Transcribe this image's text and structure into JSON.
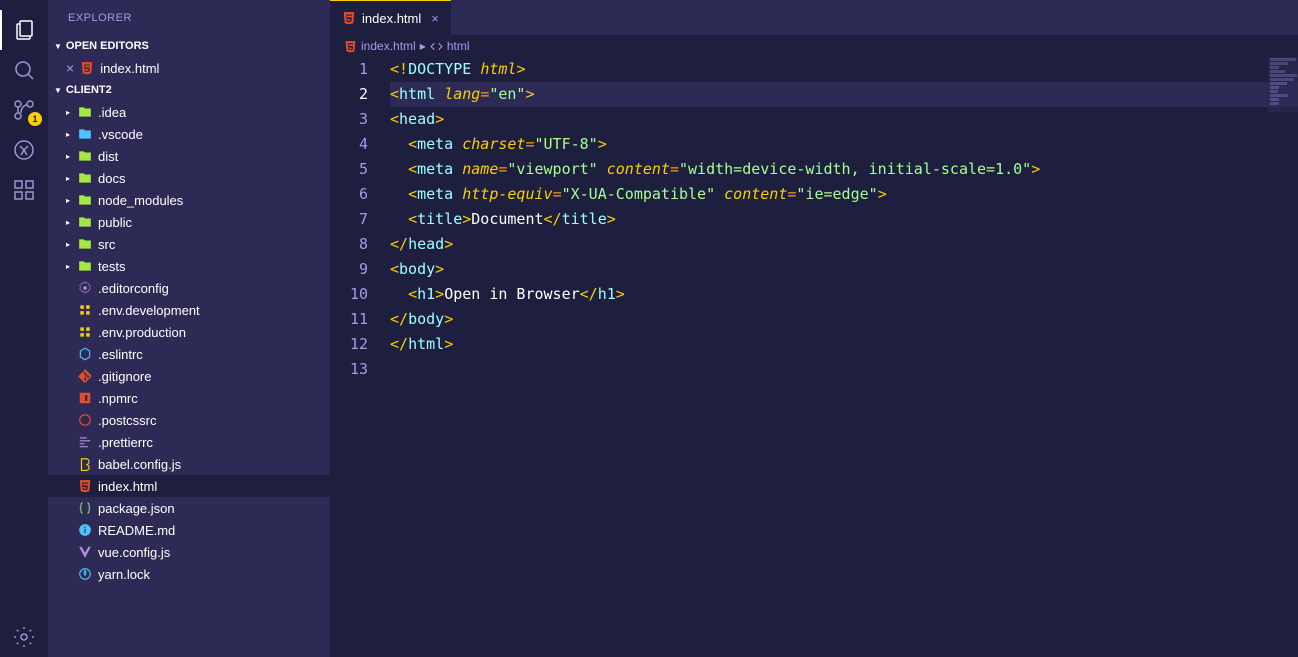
{
  "sidebar_title": "EXPLORER",
  "sections": {
    "open_editors": "OPEN EDITORS",
    "project": "CLIENT2"
  },
  "open_editors": [
    {
      "name": "index.html"
    }
  ],
  "scm_badge": "1",
  "tree": [
    {
      "name": ".idea",
      "type": "folder",
      "icon": "folder",
      "color": "folder-icon"
    },
    {
      "name": ".vscode",
      "type": "folder",
      "icon": "folder",
      "color": "folder-icon-blue"
    },
    {
      "name": "dist",
      "type": "folder",
      "icon": "folder",
      "color": "folder-icon"
    },
    {
      "name": "docs",
      "type": "folder",
      "icon": "folder",
      "color": "folder-icon"
    },
    {
      "name": "node_modules",
      "type": "folder",
      "icon": "folder",
      "color": "folder-icon"
    },
    {
      "name": "public",
      "type": "folder",
      "icon": "folder",
      "color": "folder-icon"
    },
    {
      "name": "src",
      "type": "folder",
      "icon": "folder",
      "color": "folder-icon"
    },
    {
      "name": "tests",
      "type": "folder",
      "icon": "folder",
      "color": "folder-icon"
    },
    {
      "name": ".editorconfig",
      "type": "file",
      "icon": "gear",
      "color": "file-purple"
    },
    {
      "name": ".env.development",
      "type": "file",
      "icon": "env",
      "color": "file-yellow"
    },
    {
      "name": ".env.production",
      "type": "file",
      "icon": "env",
      "color": "file-yellow"
    },
    {
      "name": ".eslintrc",
      "type": "file",
      "icon": "eslint",
      "color": "file-blue"
    },
    {
      "name": ".gitignore",
      "type": "file",
      "icon": "git",
      "color": "file-orange"
    },
    {
      "name": ".npmrc",
      "type": "file",
      "icon": "npm",
      "color": "file-red"
    },
    {
      "name": ".postcssrc",
      "type": "file",
      "icon": "postcss",
      "color": "file-red"
    },
    {
      "name": ".prettierrc",
      "type": "file",
      "icon": "prettier",
      "color": "file-purple"
    },
    {
      "name": "babel.config.js",
      "type": "file",
      "icon": "babel",
      "color": "file-yellow"
    },
    {
      "name": "index.html",
      "type": "file",
      "icon": "html",
      "color": "file-orange",
      "selected": true
    },
    {
      "name": "package.json",
      "type": "file",
      "icon": "json",
      "color": "file-green"
    },
    {
      "name": "README.md",
      "type": "file",
      "icon": "info",
      "color": "file-blue"
    },
    {
      "name": "vue.config.js",
      "type": "file",
      "icon": "vue",
      "color": "file-purple"
    },
    {
      "name": "yarn.lock",
      "type": "file",
      "icon": "yarn",
      "color": "file-blue"
    }
  ],
  "tab": {
    "name": "index.html"
  },
  "breadcrumb": {
    "file": "index.html",
    "element": "html"
  },
  "code": {
    "current_line": 2,
    "lines": [
      [
        {
          "t": "bracket",
          "v": "<!"
        },
        {
          "t": "tag",
          "v": "DOCTYPE "
        },
        {
          "t": "attr",
          "v": "html"
        },
        {
          "t": "bracket",
          "v": ">"
        }
      ],
      [
        {
          "t": "bracket",
          "v": "<"
        },
        {
          "t": "tag",
          "v": "html "
        },
        {
          "t": "attr",
          "v": "lang"
        },
        {
          "t": "op",
          "v": "="
        },
        {
          "t": "str",
          "v": "\"en\""
        },
        {
          "t": "bracket",
          "v": ">"
        }
      ],
      [
        {
          "t": "bracket",
          "v": "<"
        },
        {
          "t": "tag",
          "v": "head"
        },
        {
          "t": "bracket",
          "v": ">"
        }
      ],
      [
        {
          "t": "text",
          "v": "  "
        },
        {
          "t": "bracket",
          "v": "<"
        },
        {
          "t": "tag",
          "v": "meta "
        },
        {
          "t": "attr",
          "v": "charset"
        },
        {
          "t": "op",
          "v": "="
        },
        {
          "t": "str",
          "v": "\"UTF-8\""
        },
        {
          "t": "bracket",
          "v": ">"
        }
      ],
      [
        {
          "t": "text",
          "v": "  "
        },
        {
          "t": "bracket",
          "v": "<"
        },
        {
          "t": "tag",
          "v": "meta "
        },
        {
          "t": "attr",
          "v": "name"
        },
        {
          "t": "op",
          "v": "="
        },
        {
          "t": "str",
          "v": "\"viewport\""
        },
        {
          "t": "tag",
          "v": " "
        },
        {
          "t": "attr",
          "v": "content"
        },
        {
          "t": "op",
          "v": "="
        },
        {
          "t": "str",
          "v": "\"width=device-width, initial-scale=1.0\""
        },
        {
          "t": "bracket",
          "v": ">"
        }
      ],
      [
        {
          "t": "text",
          "v": "  "
        },
        {
          "t": "bracket",
          "v": "<"
        },
        {
          "t": "tag",
          "v": "meta "
        },
        {
          "t": "attr",
          "v": "http-equiv"
        },
        {
          "t": "op",
          "v": "="
        },
        {
          "t": "str",
          "v": "\"X-UA-Compatible\""
        },
        {
          "t": "tag",
          "v": " "
        },
        {
          "t": "attr",
          "v": "content"
        },
        {
          "t": "op",
          "v": "="
        },
        {
          "t": "str",
          "v": "\"ie=edge\""
        },
        {
          "t": "bracket",
          "v": ">"
        }
      ],
      [
        {
          "t": "text",
          "v": "  "
        },
        {
          "t": "bracket",
          "v": "<"
        },
        {
          "t": "tag",
          "v": "title"
        },
        {
          "t": "bracket",
          "v": ">"
        },
        {
          "t": "text",
          "v": "Document"
        },
        {
          "t": "bracket",
          "v": "</"
        },
        {
          "t": "tag",
          "v": "title"
        },
        {
          "t": "bracket",
          "v": ">"
        }
      ],
      [
        {
          "t": "bracket",
          "v": "</"
        },
        {
          "t": "tag",
          "v": "head"
        },
        {
          "t": "bracket",
          "v": ">"
        }
      ],
      [
        {
          "t": "bracket",
          "v": "<"
        },
        {
          "t": "tag",
          "v": "body"
        },
        {
          "t": "bracket",
          "v": ">"
        }
      ],
      [
        {
          "t": "text",
          "v": "  "
        },
        {
          "t": "bracket",
          "v": "<"
        },
        {
          "t": "tag",
          "v": "h1"
        },
        {
          "t": "bracket",
          "v": ">"
        },
        {
          "t": "text",
          "v": "Open in Browser"
        },
        {
          "t": "bracket",
          "v": "</"
        },
        {
          "t": "tag",
          "v": "h1"
        },
        {
          "t": "bracket",
          "v": ">"
        }
      ],
      [
        {
          "t": "bracket",
          "v": "</"
        },
        {
          "t": "tag",
          "v": "body"
        },
        {
          "t": "bracket",
          "v": ">"
        }
      ],
      [
        {
          "t": "bracket",
          "v": "</"
        },
        {
          "t": "tag",
          "v": "html"
        },
        {
          "t": "bracket",
          "v": ">"
        }
      ],
      []
    ]
  }
}
